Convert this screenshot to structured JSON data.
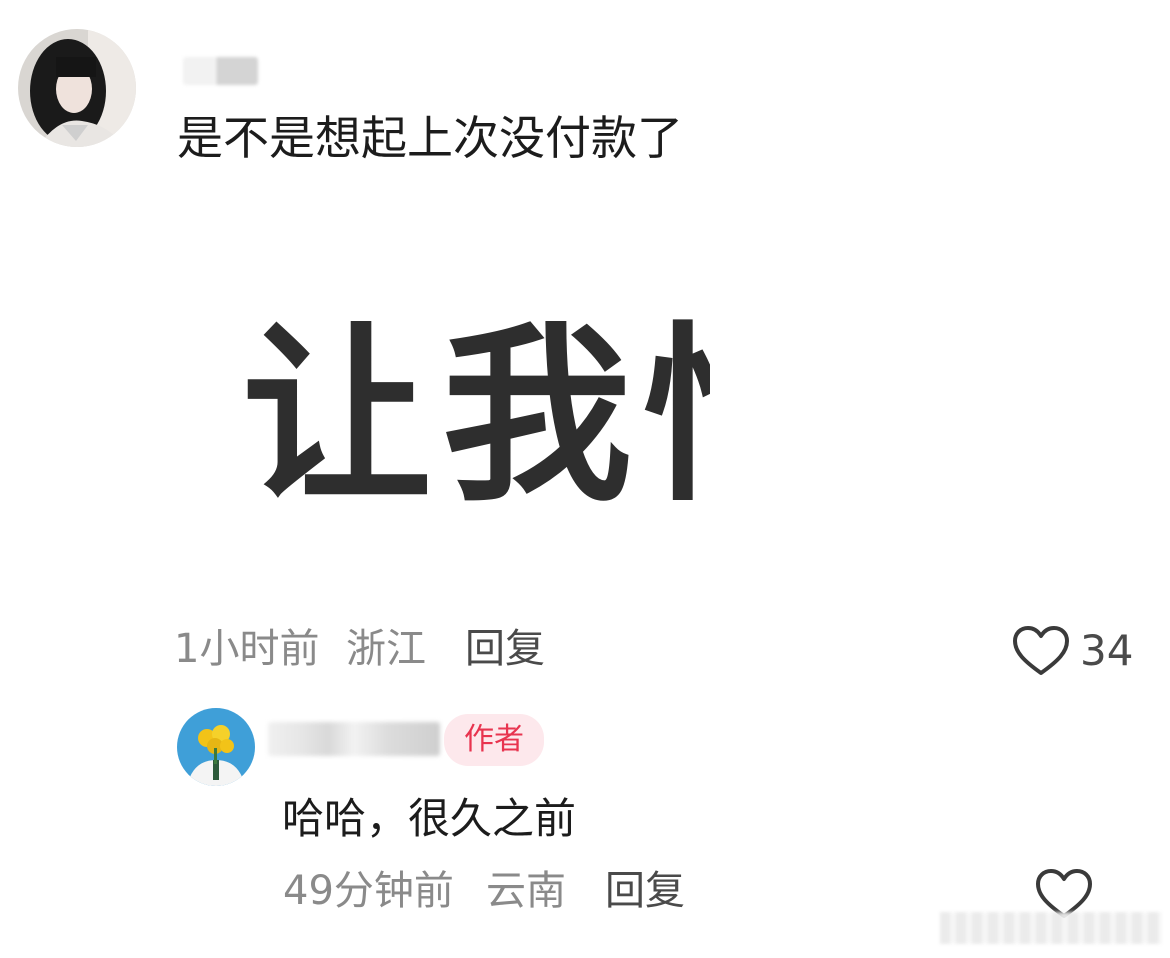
{
  "comment": {
    "text": "是不是想起上次没付款了",
    "sticker_text": "让我悄",
    "time": "1小时前",
    "region": "浙江",
    "reply_label": "回复",
    "like_count": "34"
  },
  "reply_comment": {
    "badge": "作者",
    "text": "哈哈，很久之前",
    "time": "49分钟前",
    "region": "云南",
    "reply_label": "回复"
  },
  "icons": {
    "like": "heart-outline-icon"
  },
  "colors": {
    "badge_text": "#e8344f",
    "badge_bg": "#fde8ec",
    "meta_text": "#8a8a8a"
  }
}
